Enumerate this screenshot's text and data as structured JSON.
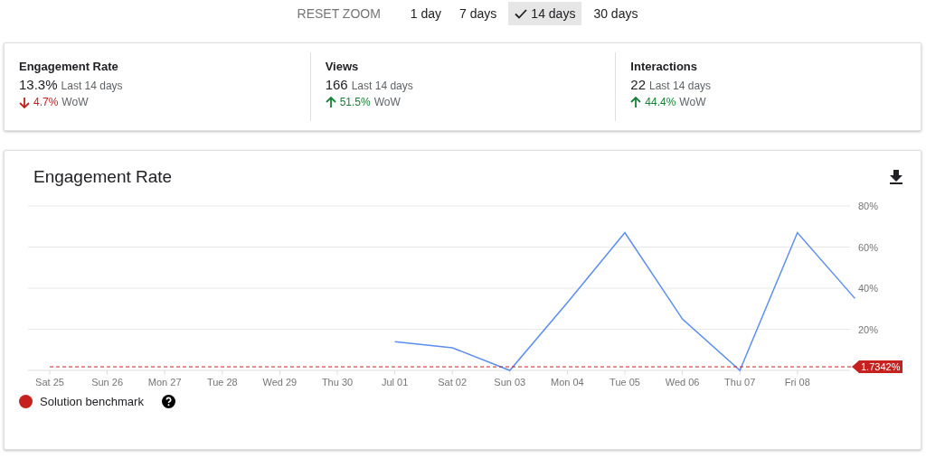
{
  "zoom_bar": {
    "reset": "RESET ZOOM",
    "ranges": [
      {
        "label": "1 day",
        "selected": false
      },
      {
        "label": "7 days",
        "selected": false
      },
      {
        "label": "14 days",
        "selected": true
      },
      {
        "label": "30 days",
        "selected": false
      }
    ]
  },
  "metrics": [
    {
      "title": "Engagement Rate",
      "value": "13.3%",
      "period": "Last 14 days",
      "rising": false,
      "change": "4.7%",
      "unit": "WoW"
    },
    {
      "title": "Views",
      "value": "166",
      "period": "Last 14 days",
      "rising": true,
      "change": "51.5%",
      "unit": "WoW"
    },
    {
      "title": "Interactions",
      "value": "22",
      "period": "Last 14 days",
      "rising": true,
      "change": "44.4%",
      "unit": "WoW"
    }
  ],
  "chart_card": {
    "title": "Engagement Rate",
    "chart_data": {
      "type": "line",
      "categories": [
        "Sat 25",
        "Sun 26",
        "Mon 27",
        "Tue 28",
        "Wed 29",
        "Thu 30",
        "Jul 01",
        "Sat 02",
        "Sun 03",
        "Mon 04",
        "Tue 05",
        "Wed 06",
        "Thu 07",
        "Fri 08",
        null
      ],
      "series": [
        {
          "color": "#5b8def",
          "values": [
            null,
            null,
            null,
            null,
            null,
            null,
            14,
            11,
            0,
            33,
            67,
            25,
            0,
            67,
            35
          ]
        },
        {
          "name": "Solution benchmark",
          "color": "#c5221f",
          "line_style": "dashed",
          "values": [
            1.7342,
            1.7342,
            1.7342,
            1.7342,
            1.7342,
            1.7342,
            1.7342,
            1.7342,
            1.7342,
            1.7342,
            1.7342,
            1.7342,
            1.7342,
            1.7342,
            1.7342
          ]
        }
      ],
      "yticks": [
        {
          "value": 20,
          "label": "20%"
        },
        {
          "value": 40,
          "label": "40%"
        },
        {
          "value": 60,
          "label": "60%"
        },
        {
          "value": 80,
          "label": "80%"
        }
      ],
      "ylim": [
        0,
        80
      ],
      "grid": true
    },
    "benchmark_tag": "1.7342%"
  }
}
